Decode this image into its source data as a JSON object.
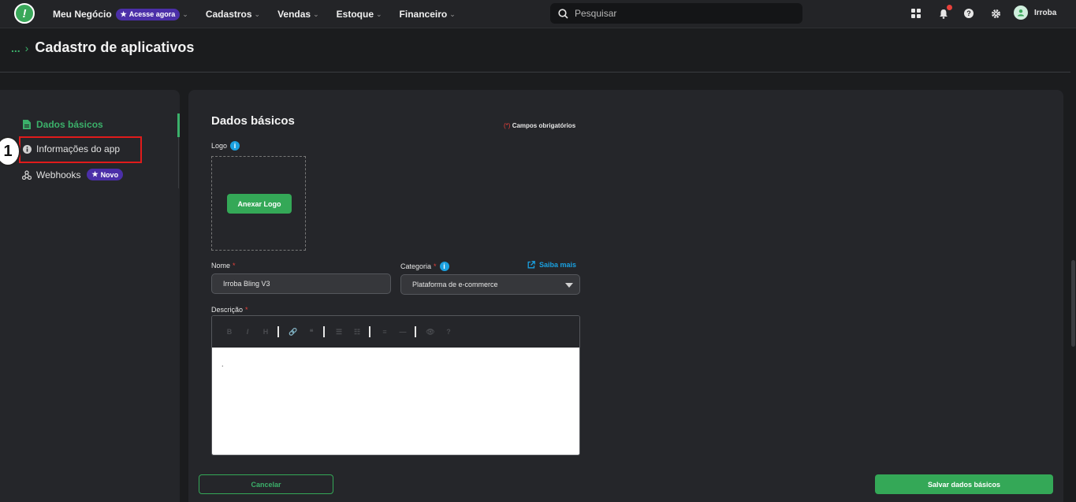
{
  "topbar": {
    "logo_glyph": "!",
    "nav": [
      {
        "label": "Meu Negócio",
        "pill": "Acesse agora"
      },
      {
        "label": "Cadastros"
      },
      {
        "label": "Vendas"
      },
      {
        "label": "Estoque"
      },
      {
        "label": "Financeiro"
      }
    ],
    "search_placeholder": "Pesquisar",
    "user_name": "Irroba"
  },
  "breadcrumb": {
    "ellipsis": "...",
    "separator": "›",
    "title": "Cadastro de aplicativos"
  },
  "sidebar": {
    "items": [
      {
        "label": "Dados básicos",
        "icon": "document-icon",
        "active": true
      },
      {
        "label": "Informações do app",
        "icon": "info-icon",
        "active": false
      },
      {
        "label": "Webhooks",
        "icon": "webhook-icon",
        "active": false,
        "badge": "Novo"
      }
    ]
  },
  "annotation": {
    "step_number": "1"
  },
  "form": {
    "title": "Dados básicos",
    "required_mark": "(*)",
    "required_note": "Campos obrigatórios",
    "logo_label": "Logo",
    "attach_logo": "Anexar Logo",
    "name_label": "Nome",
    "name_value": "Irroba Bling V3",
    "category_label": "Categoria",
    "category_value": "Plataforma de e-commerce",
    "saiba_mais": "Saiba mais",
    "description_label": "Descrição",
    "description_value": ".",
    "asterisk": "*",
    "info_glyph": "i"
  },
  "toolbar": {
    "buttons": [
      "B",
      "I",
      "H",
      "🔗",
      "❝",
      "☰",
      "☷",
      "≡",
      "—",
      "👁",
      "?"
    ]
  },
  "footer": {
    "cancel": "Cancelar",
    "save": "Salvar dados básicos"
  },
  "colors": {
    "accent_green": "#34a857",
    "purple_pill": "#4b2fa8",
    "info_blue": "#1aa0e0",
    "required_red": "#e8413b",
    "highlight_red": "#e01b1b"
  }
}
